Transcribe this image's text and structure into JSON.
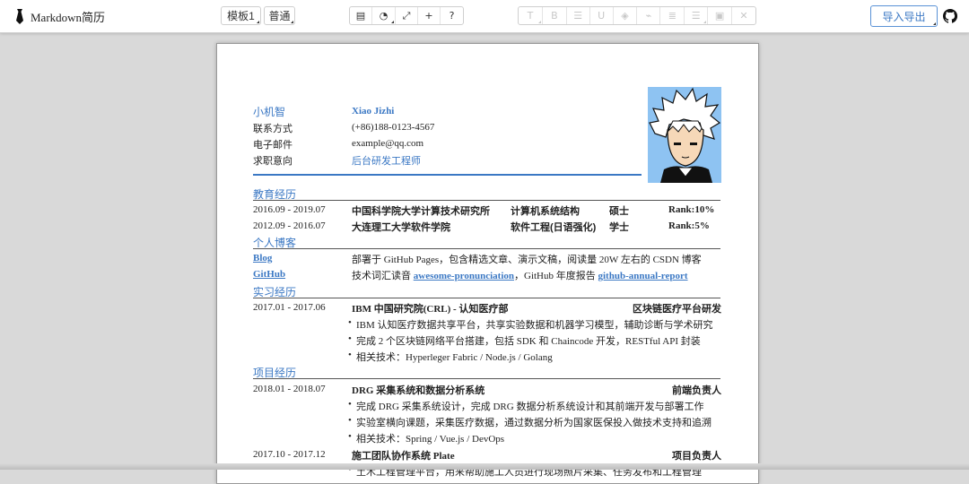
{
  "app": {
    "title": "Markdown简历"
  },
  "toolbar": {
    "template_label": "模板1",
    "style_label": "普通",
    "tool_icons": [
      "table-icon",
      "palette-icon",
      "expand-icon",
      "plus-icon",
      "help-icon"
    ],
    "format_icons": [
      "text-icon",
      "bold-icon",
      "list-icon",
      "underline-icon",
      "fill-icon",
      "link-icon",
      "align-icon",
      "numbered-list-icon",
      "image-icon",
      "close-icon"
    ],
    "import_export_label": "导入导出"
  },
  "resume": {
    "name_cn": "小机智",
    "name_en": "Xiao Jizhi",
    "contact_label": "联系方式",
    "contact_value": "(+86)188-0123-4567",
    "email_label": "电子邮件",
    "email_value": "example@qq.com",
    "intent_label": "求职意向",
    "intent_value": "后台研发工程师",
    "education": {
      "title": "教育经历",
      "rows": [
        {
          "date": "2016.09 - 2019.07",
          "school": "中国科学院大学计算技术研究所",
          "major": "计算机系统结构",
          "degree": "硕士",
          "rank": "Rank:10%"
        },
        {
          "date": "2012.09 - 2016.07",
          "school": "大连理工大学软件学院",
          "major": "软件工程(日语强化)",
          "degree": "学士",
          "rank": "Rank:5%"
        }
      ]
    },
    "blog": {
      "title": "个人博客",
      "blog_label": "Blog",
      "blog_text": "部署于 GitHub Pages，包含精选文章、演示文稿，阅读量 20W 左右的 CSDN 博客",
      "github_label": "GitHub",
      "github_text_1": "技术词汇读音 ",
      "github_link_1": "awesome-pronunciation",
      "github_text_2": "，GitHub 年度报告 ",
      "github_link_2": "github-annual-report"
    },
    "internship": {
      "title": "实习经历",
      "date": "2017.01 - 2017.06",
      "company": "IBM 中国研究院(CRL) - 认知医疗部",
      "role": "区块链医疗平台研发",
      "bullets": [
        "IBM 认知医疗数据共享平台，共享实验数据和机器学习模型，辅助诊断与学术研究",
        "完成 2 个区块链网络平台搭建，包括 SDK 和 Chaincode 开发，RESTful API 封装",
        "相关技术：Hyperleger Fabric / Node.js / Golang"
      ]
    },
    "projects": {
      "title": "项目经历",
      "items": [
        {
          "date": "2018.01 - 2018.07",
          "name": "DRG 采集系统和数据分析系统",
          "role": "前端负责人",
          "bullets": [
            "完成 DRG 采集系统设计，完成 DRG 数据分析系统设计和其前端开发与部署工作",
            "实验室横向课题，采集医疗数据，通过数据分析为国家医保投入做技术支持和追溯",
            "相关技术：Spring / Vue.js / DevOps"
          ]
        },
        {
          "date": "2017.10 - 2017.12",
          "name": "施工团队协作系统 Plate",
          "role": "项目负责人",
          "bullets": [
            "土木工程管理平台，用来帮助施工人员进行现场照片采集、任务发布和工程管理"
          ]
        }
      ]
    }
  }
}
